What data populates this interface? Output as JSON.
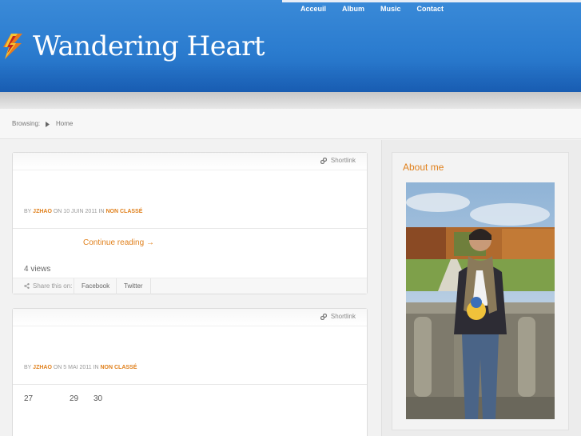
{
  "header": {
    "site_title": "Wandering Heart",
    "logo_icon": "lightning-bolt-icon",
    "nav": [
      "Acceuil",
      "Album",
      "Music",
      "Contact"
    ]
  },
  "breadcrumb": {
    "label": "Browsing:",
    "separator_icon": "chevron-right-icon",
    "current": "Home"
  },
  "posts": [
    {
      "shortlink": "Shortlink",
      "by": "BY",
      "author": "JZHAO",
      "on": "ON 10 JUIN 2011 IN",
      "category": "NON CLASSÉ",
      "continue": "Continue reading →",
      "views": "4 views",
      "share_label": "Share this on:",
      "share_buttons": [
        "Facebook",
        "Twitter"
      ]
    },
    {
      "shortlink": "Shortlink",
      "by": "BY",
      "author": "JZHAO",
      "on": "ON 5 MAI 2011 IN",
      "category": "NON CLASSÉ",
      "days": [
        "27",
        "29",
        "30"
      ]
    }
  ],
  "sidebar": {
    "widget_title": "About me"
  },
  "colors": {
    "accent": "#e0801c",
    "header_blue": "#2b7ccf"
  }
}
